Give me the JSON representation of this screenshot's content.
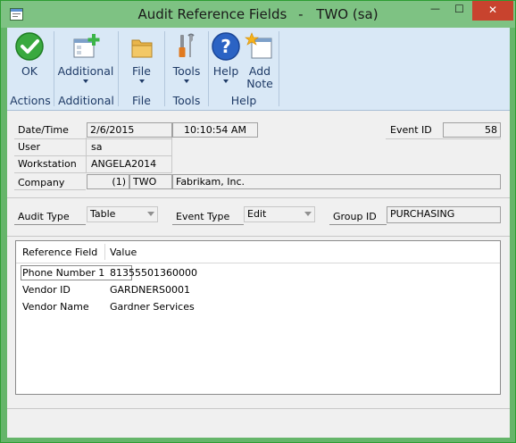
{
  "window": {
    "title": "Audit Reference Fields",
    "title_separator": "-",
    "company_user": "TWO (sa)",
    "minimize_glyph": "—",
    "maximize_glyph": "☐",
    "close_glyph": "✕"
  },
  "ribbon": {
    "ok_label": "OK",
    "additional_label": "Additional",
    "file_label": "File",
    "tools_label": "Tools",
    "help_label": "Help",
    "add_note_label_1": "Add",
    "add_note_label_2": "Note",
    "groups": {
      "actions": "Actions",
      "additional": "Additional",
      "file": "File",
      "tools": "Tools",
      "help": "Help"
    },
    "colors": {
      "ok_green": "#3aa93f",
      "add_green": "#3bb548",
      "help_blue": "#2b63c4",
      "folder": "#e9b54a"
    }
  },
  "header": {
    "datetime_label": "Date/Time",
    "date_value": "2/6/2015",
    "time_value": "10:10:54 AM",
    "event_id_label": "Event ID",
    "event_id_value": "58",
    "user_label": "User",
    "user_value": "sa",
    "workstation_label": "Workstation",
    "workstation_value": "ANGELA2014",
    "company_label": "Company",
    "company_num": "(1)",
    "company_id": "TWO",
    "company_name": "Fabrikam, Inc."
  },
  "filters": {
    "audit_type_label": "Audit Type",
    "audit_type_value": "Table",
    "event_type_label": "Event Type",
    "event_type_value": "Edit",
    "group_id_label": "Group ID",
    "group_id_value": "PURCHASING"
  },
  "grid": {
    "columns": [
      "Reference Field",
      "Value"
    ],
    "rows": [
      {
        "field": "Phone Number 1",
        "value": "81355501360000"
      },
      {
        "field": "Vendor ID",
        "value": "GARDNERS0001"
      },
      {
        "field": "Vendor Name",
        "value": "Gardner Services"
      }
    ]
  }
}
